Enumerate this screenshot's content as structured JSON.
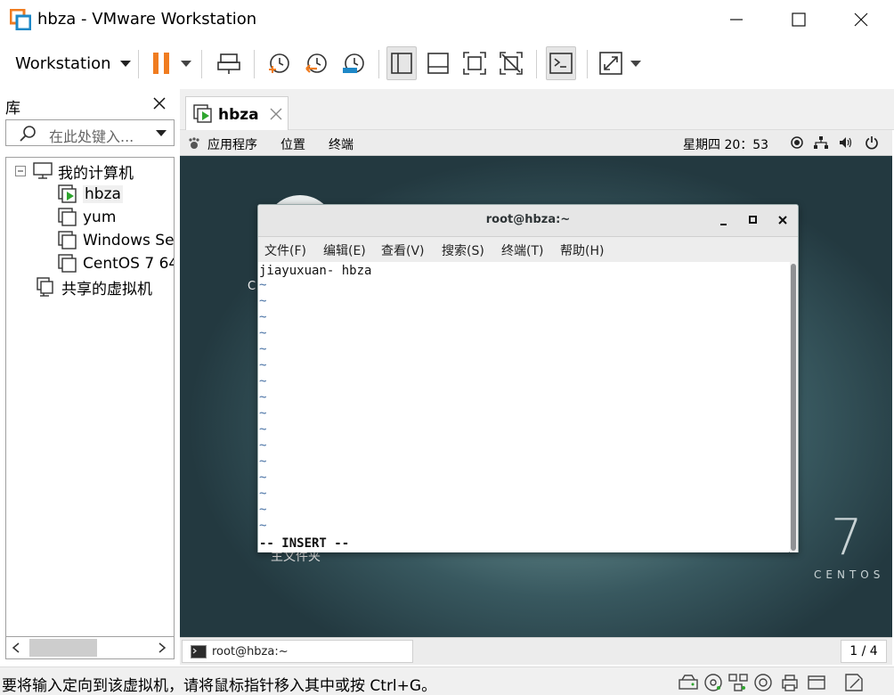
{
  "window": {
    "title": "hbza - VMware Workstation"
  },
  "toolbar": {
    "workstation_label": "Workstation"
  },
  "library": {
    "title": "库",
    "search_placeholder": "在此处键入...",
    "tree": {
      "my_computer": "我的计算机",
      "vms": [
        "hbza",
        "yum",
        "Windows Se",
        "CentOS 7 64"
      ],
      "shared": "共享的虚拟机"
    }
  },
  "vm_tab": {
    "label": "hbza"
  },
  "guest": {
    "menu": {
      "apps": "应用程序",
      "places": "位置",
      "terminal": "终端"
    },
    "clock": "星期四 20：53",
    "desktop_brand_number": "7",
    "desktop_brand_text": "CENTOS",
    "desktop_home_label": "主文件夹"
  },
  "terminal": {
    "title": "root@hbza:~",
    "menu": [
      "文件(F)",
      "编辑(E)",
      "查看(V)",
      "搜索(S)",
      "终端(T)",
      "帮助(H)"
    ],
    "first_line": "jiayuxuan- hbza",
    "tilde": "~",
    "mode_line": "-- INSERT --"
  },
  "taskbar": {
    "item_label": "root@hbza:~",
    "pager": "1 / 4"
  },
  "statusbar": {
    "message": "要将输入定向到该虚拟机，请将鼠标指针移入其中或按 Ctrl+G。"
  },
  "colors": {
    "pause": "#f07c20",
    "accent_blue": "#1e88c7",
    "play_green": "#2ea52e"
  }
}
